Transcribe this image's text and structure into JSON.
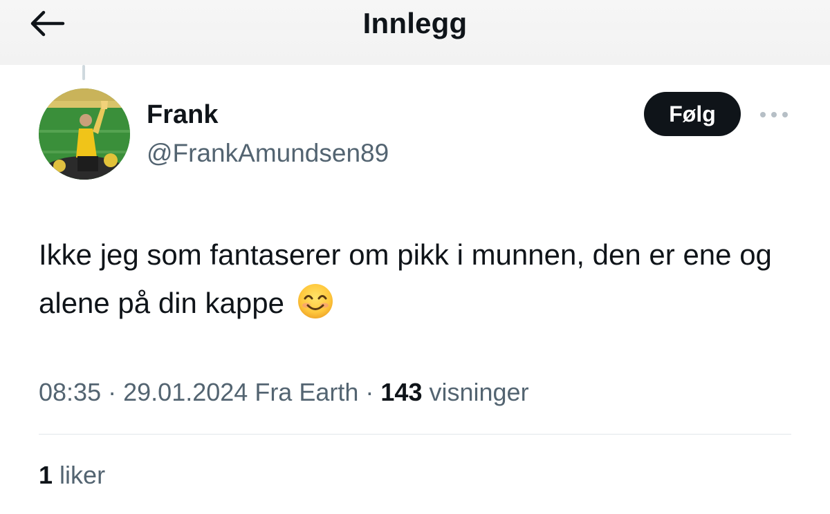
{
  "header": {
    "title": "Innlegg",
    "back_icon": "arrow-left-icon"
  },
  "author": {
    "display_name": "Frank",
    "handle": "@FrankAmundsen89",
    "avatar_icon": "avatar-photo"
  },
  "actions": {
    "follow_label": "Følg",
    "more_icon": "more-dots-icon"
  },
  "tweet": {
    "text": "Ikke jeg som fantaserer om pikk i munnen, den er ene og alene på din kappe",
    "emoji_icon": "smiling-face-emoji"
  },
  "meta": {
    "time": "08:35",
    "separator": "·",
    "date": "29.01.2024",
    "source": "Fra Earth",
    "views_count": "143",
    "views_label": "visninger"
  },
  "stats": {
    "likes_count": "1",
    "likes_label": "liker"
  },
  "colors": {
    "text_primary": "#0f1419",
    "text_secondary": "#536471",
    "follow_bg": "#0f1419",
    "divider": "#e1e6ea"
  }
}
